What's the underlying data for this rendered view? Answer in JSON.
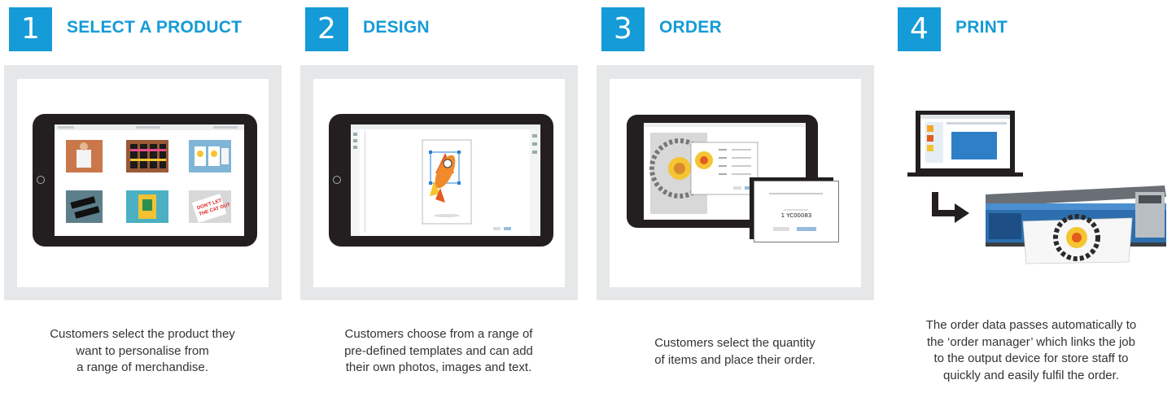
{
  "steps": [
    {
      "number": "1",
      "title": "SELECT A PRODUCT",
      "description": [
        "Customers select the product they",
        "want to personalise from",
        "a range of merchandise."
      ]
    },
    {
      "number": "2",
      "title": "DESIGN",
      "description": [
        "Customers choose from a range of",
        "pre-defined templates and can add",
        "their own photos, images and text."
      ]
    },
    {
      "number": "3",
      "title": "ORDER",
      "description": [
        "Customers select the quantity",
        "of items and place their order."
      ],
      "order_number": "1 YC00083"
    },
    {
      "number": "4",
      "title": "PRINT",
      "description": [
        "The order data passes automatically to",
        "the ‘order manager’ which links the job",
        "to the output device for store staff to",
        "quickly and easily fulfil the order."
      ]
    }
  ],
  "colors": {
    "accent": "#159bd7",
    "frame": "#e6e7e8",
    "tablet": "#231f20",
    "text": "#333333"
  }
}
